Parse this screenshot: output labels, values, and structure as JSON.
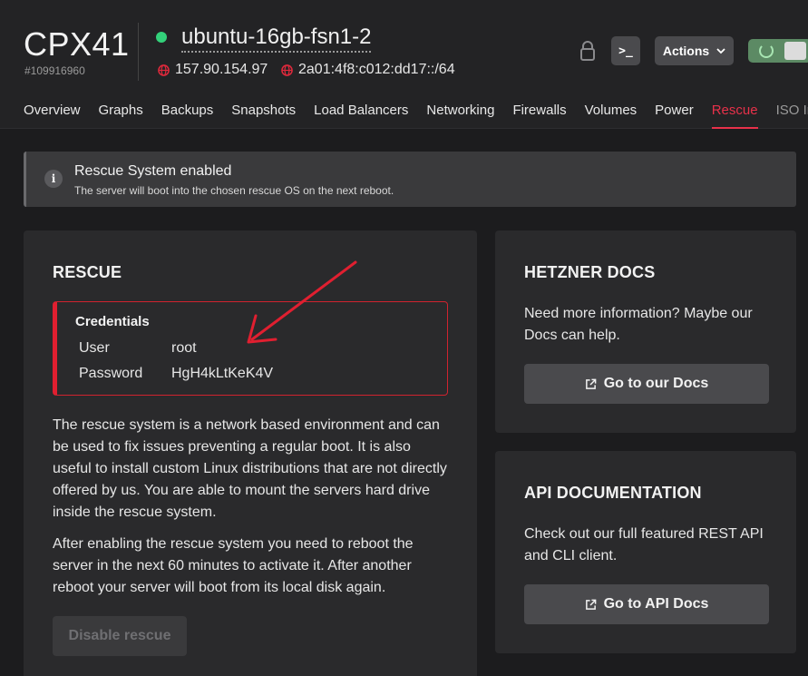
{
  "header": {
    "server_type": "CPX41",
    "server_id": "#109916960",
    "server_name": "ubuntu-16gb-fsn1-2",
    "ipv4": "157.90.154.97",
    "ipv6": "2a01:4f8:c012:dd17::/64",
    "console_label": ">_",
    "actions_label": "Actions",
    "status_color": "#33d17a"
  },
  "tabs": [
    {
      "label": "Overview"
    },
    {
      "label": "Graphs"
    },
    {
      "label": "Backups"
    },
    {
      "label": "Snapshots"
    },
    {
      "label": "Load Balancers"
    },
    {
      "label": "Networking"
    },
    {
      "label": "Firewalls"
    },
    {
      "label": "Volumes"
    },
    {
      "label": "Power"
    },
    {
      "label": "Rescue"
    },
    {
      "label": "ISO Images"
    }
  ],
  "alert": {
    "title": "Rescue System enabled",
    "text": "The server will boot into the chosen rescue OS on the next reboot."
  },
  "rescue": {
    "title": "RESCUE",
    "credentials_title": "Credentials",
    "user_label": "User",
    "user_value": "root",
    "password_label": "Password",
    "password_value": "HgH4kLtKeK4V",
    "paragraph1": "The rescue system is a network based environment and can be used to fix issues preventing a regular boot. It is also useful to install custom Linux distributions that are not directly offered by us. You are able to mount the servers hard drive inside the rescue system.",
    "paragraph2": "After enabling the rescue system you need to reboot the server in the next 60 minutes to activate it. After another reboot your server will boot from its local disk again.",
    "disable_label": "Disable rescue"
  },
  "docs": {
    "title": "HETZNER DOCS",
    "text": "Need more information? Maybe our Docs can help.",
    "button_label": "Go to our Docs"
  },
  "api": {
    "title": "API DOCUMENTATION",
    "text": "Check out our full featured REST API and CLI client.",
    "button_label": "Go to API Docs"
  },
  "colors": {
    "accent": "#e7314a",
    "annotation_arrow": "#e01f30"
  }
}
